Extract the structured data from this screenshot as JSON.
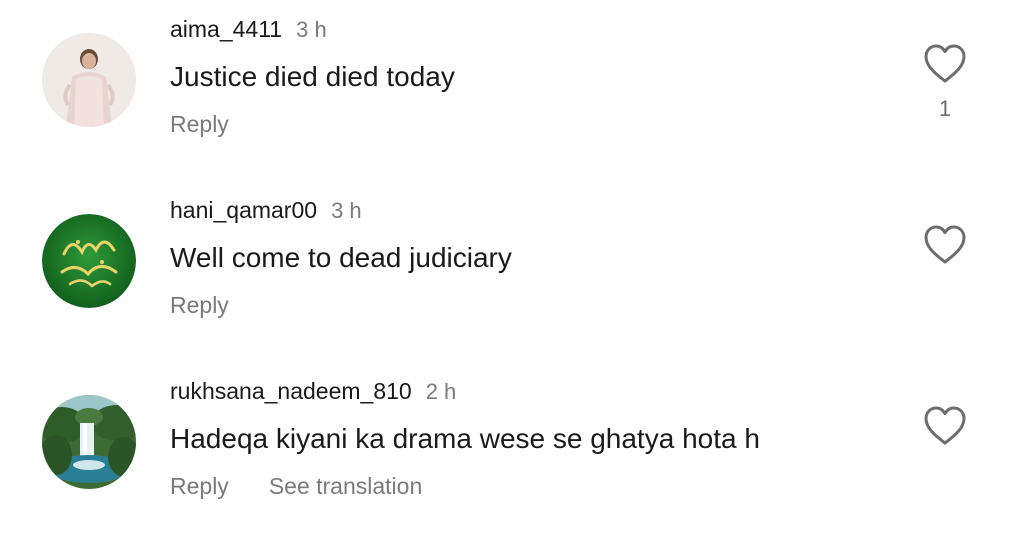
{
  "comments": [
    {
      "username": "aima_4411",
      "time": "3 h",
      "text": "Justice died died today",
      "reply_label": "Reply",
      "like_count": "1",
      "avatar_icon": "profile-photo-woman"
    },
    {
      "username": "hani_qamar00",
      "time": "3 h",
      "text": "Well come to dead judiciary",
      "reply_label": "Reply",
      "avatar_icon": "profile-photo-calligraphy"
    },
    {
      "username": "rukhsana_nadeem_810",
      "time": "2 h",
      "text": "Hadeqa kiyani ka drama wese se ghatya hota h",
      "reply_label": "Reply",
      "translation_label": "See translation",
      "avatar_icon": "profile-photo-waterfall"
    }
  ],
  "icons": {
    "like": "heart-outline-icon"
  },
  "colors": {
    "text": "#1a1a1a",
    "secondary": "#7a7a7a",
    "heart_stroke": "#6d6d6d",
    "calligraphy_green": "#1f7a2c"
  }
}
